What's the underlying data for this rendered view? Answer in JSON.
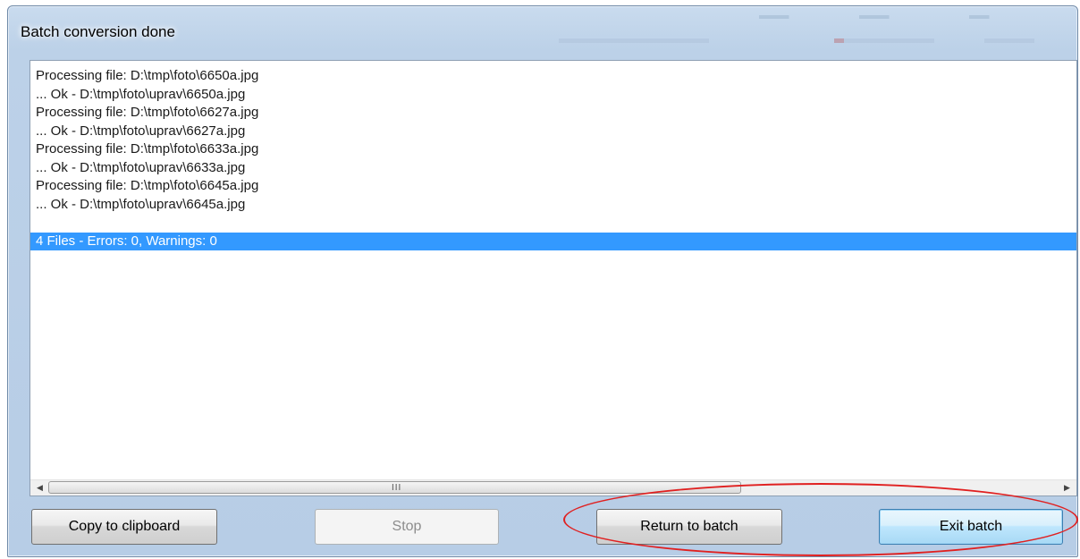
{
  "window": {
    "title": "Batch conversion done"
  },
  "log": {
    "lines": [
      "Processing file: D:\\tmp\\foto\\6650a.jpg",
      "... Ok - D:\\tmp\\foto\\uprav\\6650a.jpg",
      "Processing file: D:\\tmp\\foto\\6627a.jpg",
      "... Ok - D:\\tmp\\foto\\uprav\\6627a.jpg",
      "Processing file: D:\\tmp\\foto\\6633a.jpg",
      "... Ok - D:\\tmp\\foto\\uprav\\6633a.jpg",
      "Processing file: D:\\tmp\\foto\\6645a.jpg",
      "... Ok - D:\\tmp\\foto\\uprav\\6645a.jpg",
      "",
      "4 Files - Errors: 0, Warnings: 0"
    ],
    "selected_index": 9,
    "scrollbar_grip": "III"
  },
  "buttons": {
    "copy": "Copy to clipboard",
    "stop": "Stop",
    "return": "Return to batch",
    "exit": "Exit batch"
  },
  "icons": {
    "scroll_left": "arrow-left-icon",
    "scroll_right": "arrow-right-icon"
  },
  "colors": {
    "selection": "#3399ff",
    "annotation": "#e02020"
  }
}
